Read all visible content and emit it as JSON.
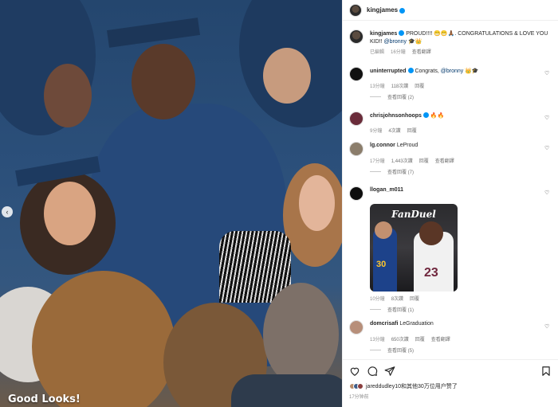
{
  "photo": {
    "overlay_text": "Good Looks!",
    "prev_glyph": "‹"
  },
  "header": {
    "username": "kingjames"
  },
  "caption": {
    "username": "kingjames",
    "text": "PROUD!!!! 😁😁🙏🏾. CONGRATULATIONS & LOVE YOU KID!! ",
    "mention": "@bronny",
    "emoji_tail": " 🎓👑",
    "edited": "已編輯",
    "time": "16分鐘",
    "translate": "查看翻譯"
  },
  "comments": [
    {
      "username": "uninterrupted",
      "text": " Congrats, ",
      "mention": "@bronny",
      "emoji_tail": " 👑🎓",
      "time": "13分鐘",
      "likes": "118次讚",
      "reply": "回覆",
      "replies": "查看回覆 (2)",
      "avatar_color": "#111111"
    },
    {
      "username": "chrisjohnsonhoops",
      "text": " 🔥🔥",
      "time": "9分鐘",
      "likes": "4次讚",
      "reply": "回覆",
      "avatar_color": "#6a2c3a"
    },
    {
      "username": "lg.connor",
      "text": " LeProud",
      "time": "17分鐘",
      "likes": "1,443次讚",
      "reply": "回覆",
      "translate": "查看翻譯",
      "replies": "查看回覆 (7)",
      "avatar_color": "#8b7d6b"
    },
    {
      "username": "llogan_m011",
      "text": "",
      "sticker_text": "FanDuel",
      "jersey_left": "30",
      "jersey_right": "23",
      "time": "10分鐘",
      "likes": "8次讚",
      "reply": "回覆",
      "replies": "查看回覆 (1)",
      "avatar_color": "#0d0d0d"
    },
    {
      "username": "domcrisafi",
      "text": " LeGraduation",
      "time": "13分鐘",
      "likes": "650次讚",
      "reply": "回覆",
      "translate": "查看翻譯",
      "replies": "查看回覆 (5)",
      "avatar_color": "#b78f7a"
    }
  ],
  "footer": {
    "liked_by": "jareddudley10和其他30万位用户赞了",
    "time": "17分钟前"
  },
  "colors": {
    "verified": "#0095f6",
    "mention": "#00376b",
    "gown": "#23466f"
  }
}
